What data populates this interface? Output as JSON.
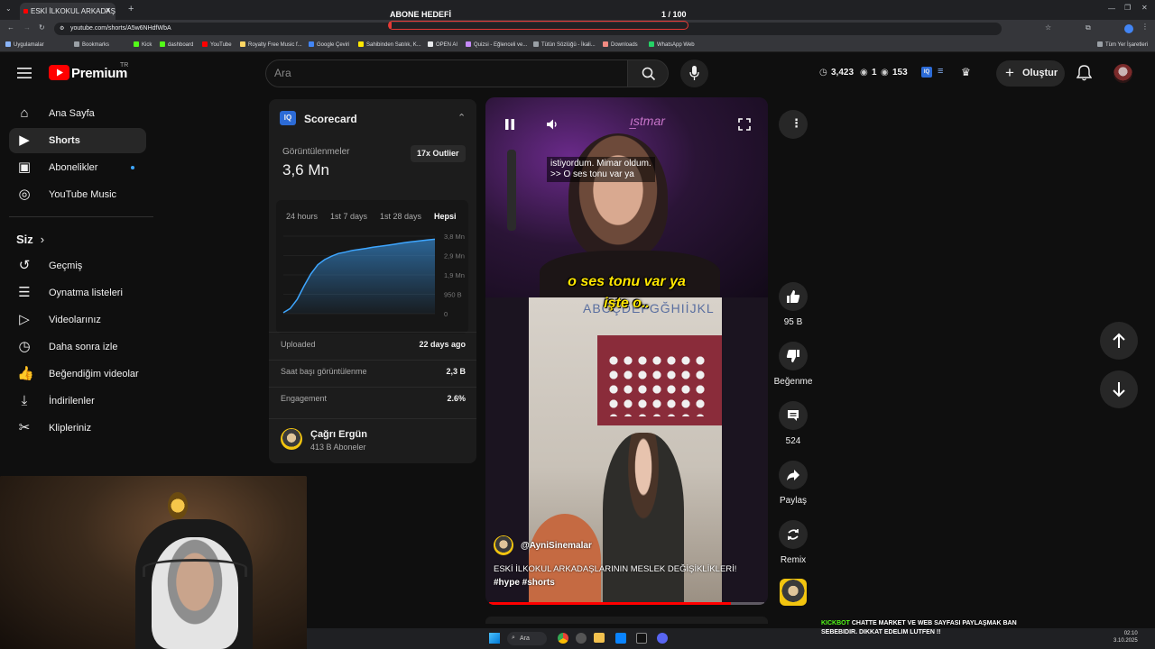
{
  "browser": {
    "tab_title": "ESKİ İLKOKUL ARKADAŞLA",
    "url": "youtube.com/shorts/A5w6NHdfWbA",
    "bookmarks": [
      {
        "label": "Uygulamalar",
        "color": "#8ab4f8"
      },
      {
        "label": "Bookmarks",
        "color": "#9aa0a6"
      },
      {
        "label": "Kick",
        "color": "#53fc18"
      },
      {
        "label": "dashboard",
        "color": "#53fc18"
      },
      {
        "label": "YouTube",
        "color": "#ff0000"
      },
      {
        "label": "Royalty Free Music f...",
        "color": "#fdd663"
      },
      {
        "label": "Google Çeviri",
        "color": "#4285f4"
      },
      {
        "label": "Sahibinden Satılık, K...",
        "color": "#ffe800"
      },
      {
        "label": "OPEN AI",
        "color": "#e8eaed"
      },
      {
        "label": "Quizsi - Eğlenceli ve...",
        "color": "#c58af9"
      },
      {
        "label": "Tütün Sözlüğü - İkali...",
        "color": "#9aa0a6"
      },
      {
        "label": "Downloads",
        "color": "#f28b82"
      },
      {
        "label": "WhatsApp Web",
        "color": "#25d366"
      }
    ],
    "all_bookmarks": "Tüm Yer İşaretleri"
  },
  "overlay": {
    "goal_label": "ABONE HEDEFİ",
    "goal_count": "1  / 100",
    "goal_progress": 0.01
  },
  "header": {
    "logo_text": "Premium",
    "logo_badge": "TR",
    "search_placeholder": "Ara",
    "stats": {
      "views": "3,423",
      "live": "1",
      "watching": "153"
    },
    "create_label": "Oluştur"
  },
  "sidebar": {
    "items": [
      {
        "label": "Ana Sayfa",
        "icon": "home-icon"
      },
      {
        "label": "Shorts",
        "icon": "shorts-icon",
        "active": true
      },
      {
        "label": "Abonelikler",
        "icon": "subscriptions-icon",
        "dot": true
      },
      {
        "label": "YouTube Music",
        "icon": "music-icon"
      }
    ],
    "you_heading": "Siz",
    "you_items": [
      {
        "label": "Geçmiş",
        "icon": "history-icon"
      },
      {
        "label": "Oynatma listeleri",
        "icon": "playlist-icon"
      },
      {
        "label": "Videolarınız",
        "icon": "video-icon"
      },
      {
        "label": "Daha sonra izle",
        "icon": "clock-icon"
      },
      {
        "label": "Beğendiğim videolar",
        "icon": "like-icon"
      },
      {
        "label": "İndirilenler",
        "icon": "download-icon"
      },
      {
        "label": "Klipleriniz",
        "icon": "scissors-icon"
      }
    ]
  },
  "scorecard": {
    "title": "Scorecard",
    "views_label": "Görüntülenmeler",
    "views_value": "3,6 Mn",
    "outlier_badge": "17x Outlier",
    "ranges": [
      "24 hours",
      "1st 7 days",
      "1st 28 days",
      "Hepsi"
    ],
    "active_range": "Hepsi",
    "y_ticks": [
      "3,8 Mn",
      "2,9 Mn",
      "1,9 Mn",
      "950 B",
      "0"
    ],
    "stats": [
      {
        "label": "Uploaded",
        "value": "22 days ago"
      },
      {
        "label": "Saat başı görüntülenme",
        "value": "2,3 B"
      },
      {
        "label": "Engagement",
        "value": "2.6%"
      }
    ],
    "channel_name": "Çağrı Ergün",
    "channel_subs": "413 B Aboneler"
  },
  "chart_data": {
    "type": "area",
    "x": [
      0,
      1,
      2,
      3,
      4,
      5,
      6,
      7,
      8,
      9,
      10,
      11,
      12,
      13,
      14,
      15,
      16,
      17,
      18,
      19,
      20,
      21,
      22
    ],
    "values": [
      0.05,
      0.25,
      0.7,
      1.35,
      1.95,
      2.4,
      2.65,
      2.82,
      2.95,
      3.02,
      3.1,
      3.15,
      3.2,
      3.26,
      3.3,
      3.35,
      3.4,
      3.45,
      3.5,
      3.54,
      3.58,
      3.62,
      3.65
    ],
    "ylim": [
      0,
      3.8
    ],
    "y_ticks": [
      "3,8 Mn",
      "2,9 Mn",
      "1,9 Mn",
      "950 B",
      "0"
    ],
    "color": "#3ea6ff"
  },
  "short": {
    "caption_line1": "istiyordum. Mimar oldum.",
    "caption_line2": ">> O ses tonu var ya",
    "subtitle_line1": "o ses tonu var ya",
    "subtitle_line2": "işte o..",
    "channel": "@AyniSinemalar",
    "title": "ESKİ İLKOKUL ARKADAŞLARININ MESLEK DEĞİŞİKLİKLERİ!",
    "hashtags": "#hype #shorts",
    "progress": 0.88,
    "classroom_letters": "ABCÇDEFGĞHIİJKL"
  },
  "actions": {
    "likes": "95 B",
    "dislike": "Beğenme",
    "comments": "524",
    "share": "Paylaş",
    "remix": "Remix"
  },
  "taskbar": {
    "search": "Ara",
    "time": "02:10",
    "date": "3.10.2025"
  },
  "kickbot": {
    "prefix": "KICKBOT",
    "line1": " CHATTE MARKET VE WEB SAYFASI PAYLAŞMAK BAN",
    "line2": "SEBEBIDIR. DIKKAT EDELIM LUTFEN !!"
  },
  "colors": {
    "yt_red": "#ff0000",
    "accent_blue": "#3ea6ff",
    "goal_red": "#e53935",
    "kick_green": "#53fc18"
  }
}
